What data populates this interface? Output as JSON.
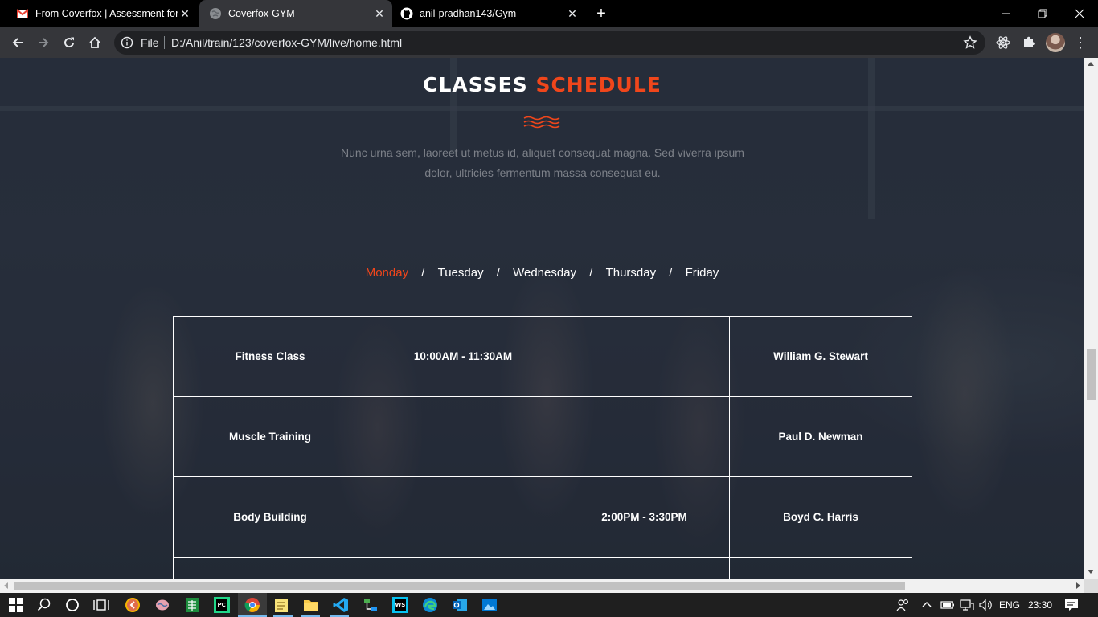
{
  "browser": {
    "tabs": [
      {
        "title": "From Coverfox | Assessment for F",
        "icon": "gmail-icon"
      },
      {
        "title": "Coverfox-GYM",
        "icon": "globe-icon",
        "active": true
      },
      {
        "title": "anil-pradhan143/Gym",
        "icon": "github-icon"
      }
    ],
    "address": {
      "scheme": "File",
      "url": "D:/Anil/train/123/coverfox-GYM/live/home.html"
    }
  },
  "page": {
    "heading_white": "CLASSES",
    "heading_accent": "SCHEDULE",
    "subtitle": "Nunc urna sem, laoreet ut metus id, aliquet consequat magna. Sed viverra ipsum dolor, ultricies fermentum massa consequat eu.",
    "days": [
      "Monday",
      "Tuesday",
      "Wednesday",
      "Thursday",
      "Friday"
    ],
    "separator": "/",
    "accent_color": "#f0461b",
    "schedule": [
      [
        "Fitness Class",
        "10:00AM - 11:30AM",
        "",
        "William G. Stewart"
      ],
      [
        "Muscle Training",
        "",
        "",
        "Paul D. Newman"
      ],
      [
        "Body Building",
        "",
        "2:00PM - 3:30PM",
        "Boyd C. Harris"
      ],
      [
        "",
        "",
        "",
        ""
      ]
    ]
  },
  "taskbar": {
    "language": "ENG",
    "time": "23:30"
  }
}
